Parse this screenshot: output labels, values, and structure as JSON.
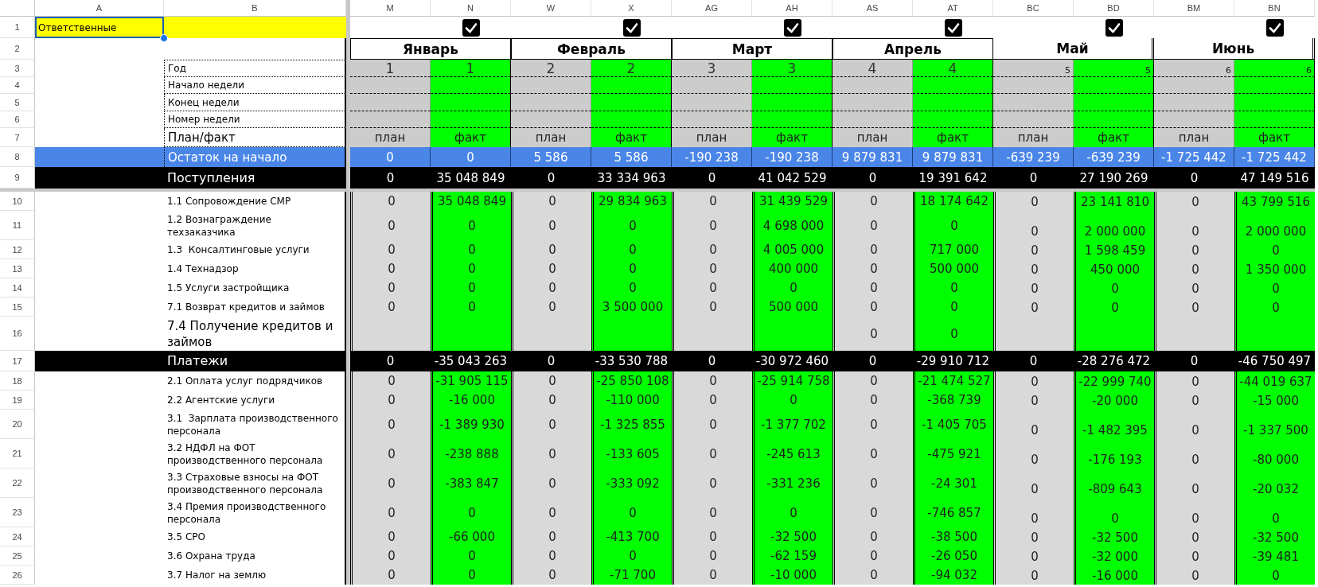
{
  "column_headers": [
    "A",
    "B",
    "M",
    "N",
    "W",
    "X",
    "AG",
    "AH",
    "AS",
    "AT",
    "BC",
    "BD",
    "BM",
    "BN"
  ],
  "months": [
    {
      "name": "Январь",
      "checked": true,
      "kind": "framed"
    },
    {
      "name": "Февраль",
      "checked": true,
      "kind": "framed"
    },
    {
      "name": "Март",
      "checked": true,
      "kind": "framed"
    },
    {
      "name": "Апрель",
      "checked": true,
      "kind": "framed"
    },
    {
      "name": "Май",
      "checked": true,
      "kind": "plain"
    },
    {
      "name": "Июнь",
      "checked": true,
      "kind": "plain"
    }
  ],
  "rows": [
    {
      "number": "1",
      "kind": "responsible",
      "label": "Ответственные",
      "selected": true
    },
    {
      "number": "2",
      "kind": "months"
    },
    {
      "number": "3",
      "kind": "year",
      "label": "Год",
      "cells": [
        "1",
        "1",
        "2",
        "2",
        "3",
        "3",
        "4",
        "4",
        "5",
        "5",
        "6",
        "6"
      ]
    },
    {
      "number": "4",
      "kind": "info",
      "label": "Начало недели"
    },
    {
      "number": "5",
      "kind": "info",
      "label": "Конец недели"
    },
    {
      "number": "6",
      "kind": "info",
      "label": "Номер недели"
    },
    {
      "number": "7",
      "kind": "plan_fact",
      "label": "План/факт",
      "cells": [
        "план",
        "факт",
        "план",
        "факт",
        "план",
        "факт",
        "план",
        "факт",
        "план",
        "факт",
        "план",
        "факт"
      ]
    },
    {
      "number": "8",
      "kind": "balance",
      "label": "Остаток на начало",
      "cells": [
        "0",
        "0",
        "5 586",
        "5 586",
        "-190 238",
        "-190 238",
        "9 879 831",
        "9 879 831",
        "-639 239",
        "-639 239",
        "-1 725 442",
        "-1 725 442"
      ]
    },
    {
      "number": "9",
      "kind": "section",
      "label": "Поступления",
      "cells": [
        "0",
        "35 048 849",
        "0",
        "33 334 963",
        "0",
        "41 042 529",
        "0",
        "19 391 642",
        "0",
        "27 190 269",
        "0",
        "47 149 516"
      ]
    },
    {
      "number": "10",
      "kind": "item",
      "label": "1.1 Сопровождение СМР",
      "cells": [
        "0",
        "35 048 849",
        "0",
        "29 834 963",
        "0",
        "31 439 529",
        "0",
        "18 174 642",
        "0",
        "23 141 810",
        "0",
        "43 799 516"
      ]
    },
    {
      "number": "11",
      "kind": "item",
      "label": "1.2 Вознаграждение\nтехзаказчика",
      "cells": [
        "0",
        "0",
        "0",
        "0",
        "0",
        "4 698 000",
        "0",
        "0",
        "0",
        "2 000 000",
        "0",
        "2 000 000"
      ]
    },
    {
      "number": "12",
      "kind": "item",
      "label": "1.3  Консалтинговые услуги",
      "cells": [
        "0",
        "0",
        "0",
        "0",
        "0",
        "4 005 000",
        "0",
        "717 000",
        "0",
        "1 598 459",
        "0",
        "0"
      ]
    },
    {
      "number": "13",
      "kind": "item",
      "label": "1.4 Технадзор",
      "cells": [
        "0",
        "0",
        "0",
        "0",
        "0",
        "400 000",
        "0",
        "500 000",
        "0",
        "450 000",
        "0",
        "1 350 000"
      ]
    },
    {
      "number": "14",
      "kind": "item",
      "label": "1.5 Услуги застройщика",
      "cells": [
        "0",
        "0",
        "0",
        "0",
        "0",
        "0",
        "0",
        "0",
        "0",
        "0",
        "0",
        "0"
      ]
    },
    {
      "number": "15",
      "kind": "item",
      "label": "7.1 Возврат кредитов и займов",
      "cells": [
        "0",
        "0",
        "0",
        "3 500 000",
        "0",
        "500 000",
        "0",
        "0",
        "0",
        "0",
        "0",
        "0"
      ]
    },
    {
      "number": "16",
      "kind": "item_large",
      "label": "7.4 Получение кредитов и\nзаймов",
      "cells": [
        null,
        null,
        null,
        null,
        null,
        null,
        "0",
        "0",
        null,
        null,
        null,
        null
      ]
    },
    {
      "number": "17",
      "kind": "section",
      "label": "Платежи",
      "cells": [
        "0",
        "-35 043 263",
        "0",
        "-33 530 788",
        "0",
        "-30 972 460",
        "0",
        "-29 910 712",
        "0",
        "-28 276 472",
        "0",
        "-46 750 497"
      ]
    },
    {
      "number": "18",
      "kind": "item",
      "label": "2.1 Оплата услуг подрядчиков",
      "cells": [
        "0",
        "-31 905 115",
        "0",
        "-25 850 108",
        "0",
        "-25 914 758",
        "0",
        "-21 474 527",
        "0",
        "-22 999 740",
        "0",
        "-44 019 637"
      ]
    },
    {
      "number": "19",
      "kind": "item",
      "label": "2.2 Агентские услуги",
      "cells": [
        "0",
        "-16 000",
        "0",
        "-110 000",
        "0",
        "0",
        "0",
        "-368 739",
        "0",
        "-20 000",
        "0",
        "-15 000"
      ]
    },
    {
      "number": "20",
      "kind": "item",
      "label": "3.1  Зарплата производственного\nперсонала",
      "cells": [
        "0",
        "-1 389 930",
        "0",
        "-1 325 855",
        "0",
        "-1 377 702",
        "0",
        "-1 405 705",
        "0",
        "-1 482 395",
        "0",
        "-1 337 500"
      ]
    },
    {
      "number": "21",
      "kind": "item",
      "label": "3.2 НДФЛ на ФОТ\nпроизводственного персонала",
      "cells": [
        "0",
        "-238 888",
        "0",
        "-133 605",
        "0",
        "-245 613",
        "0",
        "-475 921",
        "0",
        "-176 193",
        "0",
        "-80 000"
      ]
    },
    {
      "number": "22",
      "kind": "item",
      "label": "3.3 Страховые взносы на ФОТ\nпроизводственного персонала",
      "cells": [
        "0",
        "-383 847",
        "0",
        "-333 092",
        "0",
        "-331 236",
        "0",
        "-24 301",
        "0",
        "-809 643",
        "0",
        "-20 032"
      ]
    },
    {
      "number": "23",
      "kind": "item",
      "label": "3.4 Премия производственного\nперсонала",
      "cells": [
        "0",
        "0",
        "0",
        "0",
        "0",
        "0",
        "0",
        "-746 857",
        "0",
        "0",
        "0",
        "0"
      ]
    },
    {
      "number": "24",
      "kind": "item",
      "label": "3.5 СРО",
      "cells": [
        "0",
        "-66 000",
        "0",
        "-413 700",
        "0",
        "-32 500",
        "0",
        "-38 500",
        "0",
        "-32 500",
        "0",
        "-32 500"
      ]
    },
    {
      "number": "25",
      "kind": "item",
      "label": "3.6 Охрана труда",
      "cells": [
        "0",
        "0",
        "0",
        "0",
        "0",
        "-62 159",
        "0",
        "-26 050",
        "0",
        "-32 000",
        "0",
        "-39 481"
      ]
    },
    {
      "number": "26",
      "kind": "item",
      "label": "3.7 Налог на землю",
      "cells": [
        "0",
        "0",
        "0",
        "-71 700",
        "0",
        "-10 000",
        "0",
        "-94 032",
        "0",
        "-16 000",
        "0",
        "0"
      ]
    }
  ]
}
